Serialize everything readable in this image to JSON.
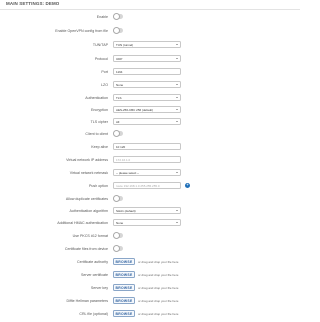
{
  "section": {
    "title": "MAIN SETTINGS: DEMO"
  },
  "fields": {
    "enable": {
      "label": "Enable"
    },
    "enable_openvpn_config": {
      "label": "Enable OpenVPN config from file"
    },
    "tun_tap": {
      "label": "TUN/TAP",
      "value": "TUN (tunnel)"
    },
    "protocol": {
      "label": "Protocol",
      "value": "UDP"
    },
    "port": {
      "label": "Port",
      "value": "1194"
    },
    "lzo": {
      "label": "LZO",
      "value": "None"
    },
    "authentication": {
      "label": "Authentication",
      "value": "TLS"
    },
    "encryption": {
      "label": "Encryption",
      "value": "AES-256-CBC 256 (default)"
    },
    "tls_cipher": {
      "label": "TLS cipher",
      "value": "All"
    },
    "client_to_client": {
      "label": "Client to client"
    },
    "keep_alive": {
      "label": "Keep alive",
      "value": "10 120"
    },
    "virtual_network_ip": {
      "label": "Virtual network IP address",
      "placeholder": "172.16.1.0"
    },
    "virtual_network_netmask": {
      "label": "Virtual network netmask",
      "value": "-- please select --"
    },
    "push_option": {
      "label": "Push option",
      "placeholder": "route 192.168.1.0 255.255.255.0"
    },
    "allow_duplicate_certificates": {
      "label": "Allow duplicate certificates"
    },
    "authentication_algorithm": {
      "label": "Authentication algorithm",
      "value": "SHA1 (default)"
    },
    "additional_hmac": {
      "label": "Additional HMAC authentication",
      "value": "None"
    },
    "use_pkcs12": {
      "label": "Use PKCS #12 format"
    },
    "certificate_from_manager": {
      "label": "Certificate files from device"
    },
    "certificate_authority": {
      "label": "Certificate authority",
      "button": "BROWSE",
      "hint": "or drag and drop your file here"
    },
    "server_certificate": {
      "label": "Server certificate",
      "button": "BROWSE",
      "hint": "or drag and drop your file here"
    },
    "server_key": {
      "label": "Server key",
      "button": "BROWSE",
      "hint": "or drag and drop your file here"
    },
    "dh_params": {
      "label": "Diffie Hellman parameters",
      "button": "BROWSE",
      "hint": "or drag and drop your file here"
    },
    "crl_file": {
      "label": "CRL file (optional)",
      "button": "BROWSE",
      "hint": "or drag and drop your file here"
    }
  },
  "icons": {
    "info": "info-icon"
  },
  "colors": {
    "accent": "#1f6fb8",
    "toggle_off": "#d6d6d6"
  }
}
